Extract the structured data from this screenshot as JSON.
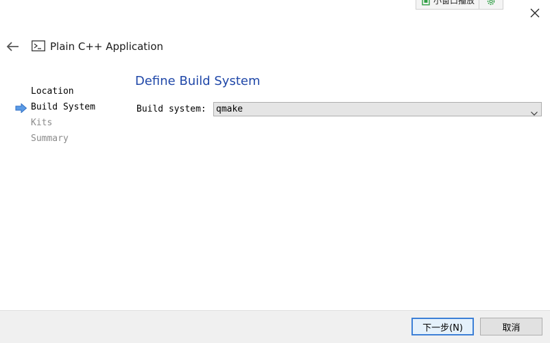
{
  "pip_bar": {
    "mini_window_label": "小窗口播放"
  },
  "header": {
    "title": "Plain C++ Application"
  },
  "steps": [
    {
      "label": "Location",
      "state": "done"
    },
    {
      "label": "Build System",
      "state": "current"
    },
    {
      "label": "Kits",
      "state": "pending"
    },
    {
      "label": "Summary",
      "state": "pending"
    }
  ],
  "page": {
    "title": "Define Build System",
    "build_system_label": "Build system:",
    "build_system_value": "qmake"
  },
  "footer": {
    "next_label": "下一步(N)",
    "cancel_label": "取消"
  },
  "colors": {
    "title_blue": "#1f47a8",
    "step_arrow_blue": "#3c7fd6",
    "pip_green": "#2f9e44"
  }
}
